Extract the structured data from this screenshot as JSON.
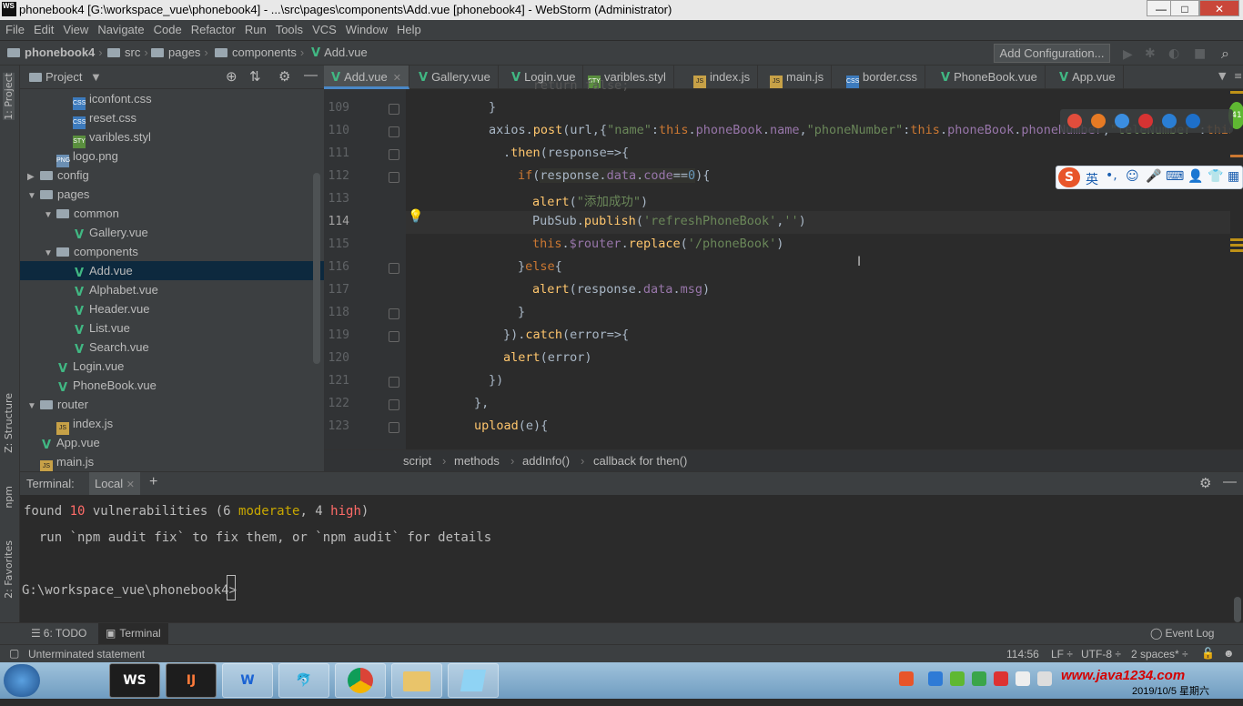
{
  "titlebar": {
    "title": "phonebook4 [G:\\workspace_vue\\phonebook4] - ...\\src\\pages\\components\\Add.vue [phonebook4] - WebStorm (Administrator)",
    "logo": "WS",
    "min": "—",
    "max": "□",
    "close": "✕"
  },
  "menu": [
    "File",
    "Edit",
    "View",
    "Navigate",
    "Code",
    "Refactor",
    "Run",
    "Tools",
    "VCS",
    "Window",
    "Help"
  ],
  "nav": {
    "project": "phonebook4",
    "crumbs": [
      "src",
      "pages",
      "components"
    ],
    "file": "Add.vue",
    "add_config": "Add Configuration..."
  },
  "left_strip": {
    "project": "1: Project",
    "structure": "Z: Structure",
    "npm": "npm",
    "favorites": "2: Favorites"
  },
  "project_panel": {
    "title": "Project",
    "tree": [
      {
        "name": "iconfont.css",
        "type": "css",
        "indent": 4
      },
      {
        "name": "reset.css",
        "type": "css",
        "indent": 4
      },
      {
        "name": "varibles.styl",
        "type": "styl",
        "indent": 4
      },
      {
        "name": "logo.png",
        "type": "png",
        "indent": 3
      },
      {
        "name": "config",
        "type": "folder",
        "indent": 2,
        "arrow": "▶"
      },
      {
        "name": "pages",
        "type": "folder",
        "indent": 2,
        "arrow": "▼"
      },
      {
        "name": "common",
        "type": "folder",
        "indent": 3,
        "arrow": "▼"
      },
      {
        "name": "Gallery.vue",
        "type": "vue",
        "indent": 4
      },
      {
        "name": "components",
        "type": "folder",
        "indent": 3,
        "arrow": "▼"
      },
      {
        "name": "Add.vue",
        "type": "vue",
        "indent": 4,
        "selected": true
      },
      {
        "name": "Alphabet.vue",
        "type": "vue",
        "indent": 4
      },
      {
        "name": "Header.vue",
        "type": "vue",
        "indent": 4
      },
      {
        "name": "List.vue",
        "type": "vue",
        "indent": 4
      },
      {
        "name": "Search.vue",
        "type": "vue",
        "indent": 4
      },
      {
        "name": "Login.vue",
        "type": "vue",
        "indent": 3
      },
      {
        "name": "PhoneBook.vue",
        "type": "vue",
        "indent": 3
      },
      {
        "name": "router",
        "type": "folder",
        "indent": 2,
        "arrow": "▼"
      },
      {
        "name": "index.js",
        "type": "js",
        "indent": 3
      },
      {
        "name": "App.vue",
        "type": "vue",
        "indent": 2
      },
      {
        "name": "main.js",
        "type": "js",
        "indent": 2
      }
    ]
  },
  "tabs": [
    {
      "label": "Add.vue",
      "icon": "vue",
      "active": true,
      "closable": true
    },
    {
      "label": "Gallery.vue",
      "icon": "vue"
    },
    {
      "label": "Login.vue",
      "icon": "vue"
    },
    {
      "label": "varibles.styl",
      "icon": "styl"
    },
    {
      "label": "index.js",
      "icon": "js"
    },
    {
      "label": "main.js",
      "icon": "js"
    },
    {
      "label": "border.css",
      "icon": "css"
    },
    {
      "label": "PhoneBook.vue",
      "icon": "vue"
    },
    {
      "label": "App.vue",
      "icon": "vue"
    }
  ],
  "editor": {
    "line_numbers": [
      "109",
      "110",
      "111",
      "112",
      "113",
      "114",
      "115",
      "116",
      "117",
      "118",
      "119",
      "120",
      "121",
      "122",
      "123"
    ],
    "current_line": "114"
  },
  "breadcrumb": [
    "script",
    "methods",
    "addInfo()",
    "callback for then()"
  ],
  "terminal": {
    "label": "Terminal:",
    "tab": "Local",
    "line1_a": "found ",
    "line1_num": "10",
    "line1_b": " vulnerabilities (6 ",
    "line1_mod": "moderate",
    "line1_c": ", 4 ",
    "line1_high": "high",
    "line1_d": ")",
    "line2": "  run `npm audit fix` to fix them, or `npm audit` for details",
    "prompt": "G:\\workspace_vue\\phonebook4>"
  },
  "bottom_tools": {
    "todo": "6: TODO",
    "terminal": "Terminal",
    "event_log": "Event Log"
  },
  "status": {
    "message": "Unterminated statement",
    "position": "114:56",
    "line_sep": "LF ÷",
    "encoding": "UTF-8 ÷",
    "indent": "2 spaces* ÷"
  },
  "taskbar": {
    "watermark": "www.java1234.com",
    "date": "2019/10/5 星期六",
    "apps": [
      "WS",
      "IJ",
      "W",
      "🐬",
      "",
      "",
      ""
    ]
  },
  "ime": {
    "lang": "英"
  }
}
